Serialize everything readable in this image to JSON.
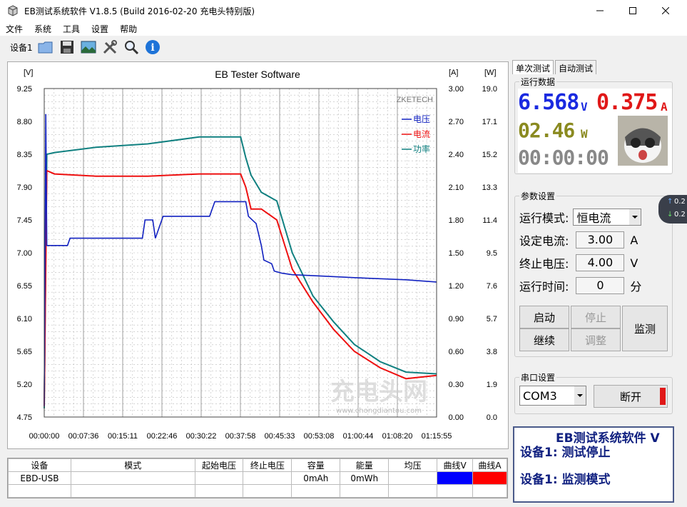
{
  "window": {
    "title": "EB测试系统软件 V1.8.5 (Build 2016-02-20 充电头特别版)"
  },
  "menu": [
    "文件",
    "系统",
    "工具",
    "设置",
    "帮助"
  ],
  "toolbar": {
    "device_label": "设备1",
    "icons": [
      "folder-icon",
      "save-icon",
      "image-icon",
      "tools-icon",
      "search-icon",
      "info-icon"
    ]
  },
  "chart_data": {
    "type": "line",
    "title": "EB Tester Software",
    "watermark": "ZKETECH",
    "y_left": {
      "unit": "[V]",
      "ticks": [
        "9.25",
        "8.80",
        "8.35",
        "7.90",
        "7.45",
        "7.00",
        "6.55",
        "6.10",
        "5.65",
        "5.20",
        "4.75"
      ],
      "ylim": [
        4.75,
        9.25
      ]
    },
    "y_mid": {
      "unit": "[A]",
      "ticks": [
        "3.00",
        "2.70",
        "2.40",
        "2.10",
        "1.80",
        "1.50",
        "1.20",
        "0.90",
        "0.60",
        "0.30",
        "0.00"
      ],
      "ylim": [
        0,
        3.0
      ]
    },
    "y_right": {
      "unit": "[W]",
      "ticks": [
        "19.0",
        "17.1",
        "15.2",
        "13.3",
        "11.4",
        "9.5",
        "7.6",
        "5.7",
        "3.8",
        "1.9",
        "0.0"
      ],
      "ylim": [
        0,
        19.0
      ]
    },
    "x_ticks": [
      "00:00:00",
      "00:07:36",
      "00:15:11",
      "00:22:46",
      "00:30:22",
      "00:37:58",
      "00:45:33",
      "00:53:08",
      "01:00:44",
      "01:08:20",
      "01:15:55"
    ],
    "xlim_minutes": [
      0,
      75.92
    ],
    "grid": true,
    "legend_position": "top-right",
    "series": [
      {
        "name": "电压",
        "color": "#1020c0",
        "axis": "V",
        "x": [
          0,
          0.3,
          0.5,
          1,
          4.5,
          5,
          10,
          19,
          19.5,
          21,
          21.5,
          23,
          32,
          33,
          39,
          39.5,
          41,
          42,
          42.5,
          44,
          44.5,
          46,
          48,
          54,
          60,
          70,
          75.9
        ],
        "y": [
          4.9,
          8.9,
          7.1,
          7.1,
          7.1,
          7.2,
          7.2,
          7.2,
          7.45,
          7.45,
          7.2,
          7.5,
          7.5,
          7.7,
          7.7,
          7.5,
          7.4,
          7.1,
          6.9,
          6.85,
          6.75,
          6.72,
          6.7,
          6.68,
          6.66,
          6.63,
          6.6
        ]
      },
      {
        "name": "电流",
        "color": "#ee1010",
        "axis": "A",
        "x": [
          0,
          0.5,
          2,
          10,
          20,
          30,
          38,
          39,
          40,
          42,
          45,
          48,
          52,
          56,
          60,
          65,
          70,
          75.9
        ],
        "y": [
          0.1,
          2.25,
          2.22,
          2.2,
          2.2,
          2.22,
          2.22,
          2.1,
          1.9,
          1.9,
          1.8,
          1.35,
          1.05,
          0.8,
          0.6,
          0.45,
          0.35,
          0.38
        ]
      },
      {
        "name": "功率",
        "color": "#108080",
        "axis": "W",
        "x": [
          0,
          0.5,
          2,
          10,
          20,
          30,
          38,
          39,
          40,
          42,
          45,
          48,
          52,
          56,
          60,
          65,
          70,
          75.9
        ],
        "y": [
          0.5,
          15.2,
          15.3,
          15.6,
          15.8,
          16.2,
          16.2,
          15.0,
          14.0,
          13.0,
          12.5,
          9.5,
          7.0,
          5.5,
          4.2,
          3.2,
          2.6,
          2.5
        ]
      }
    ]
  },
  "table": {
    "headers": [
      "设备",
      "模式",
      "起始电压",
      "终止电压",
      "容量",
      "能量",
      "均压",
      "曲线V",
      "曲线A"
    ],
    "row": [
      "EBD-USB",
      "",
      "",
      "",
      "0mAh",
      "0mWh",
      "",
      "",
      ""
    ],
    "swatch_v": "#0000ff",
    "swatch_a": "#ff0000"
  },
  "tabs": [
    "单次测试",
    "自动测试"
  ],
  "run_data": {
    "title": "运行数据",
    "voltage": "6.568",
    "voltage_unit": "V",
    "current": "0.375",
    "current_unit": "A",
    "power": "02.46",
    "power_unit": "W",
    "time": "00:00:00"
  },
  "params": {
    "title": "参数设置",
    "mode_label": "运行模式:",
    "mode_value": "恒电流",
    "current_label": "设定电流:",
    "current_value": "3.00",
    "current_unit": "A",
    "voltage_label": "终止电压:",
    "voltage_value": "4.00",
    "voltage_unit": "V",
    "time_label": "运行时间:",
    "time_value": "0",
    "time_unit": "分"
  },
  "buttons": {
    "start": "启动",
    "stop": "停止",
    "continue": "继续",
    "adjust": "调整",
    "monitor": "监测"
  },
  "serial": {
    "title": "串口设置",
    "port": "COM3",
    "disconnect": "断开"
  },
  "status": {
    "line1": "EB测试系统软件 V",
    "line2": "设备1: 测试停止",
    "line3": "设备1: 监测模式"
  },
  "float_pill": {
    "up": "0.2",
    "down": "0.2"
  },
  "watermark_text": "充电头网",
  "watermark_url": "www.chongdiantou.com"
}
